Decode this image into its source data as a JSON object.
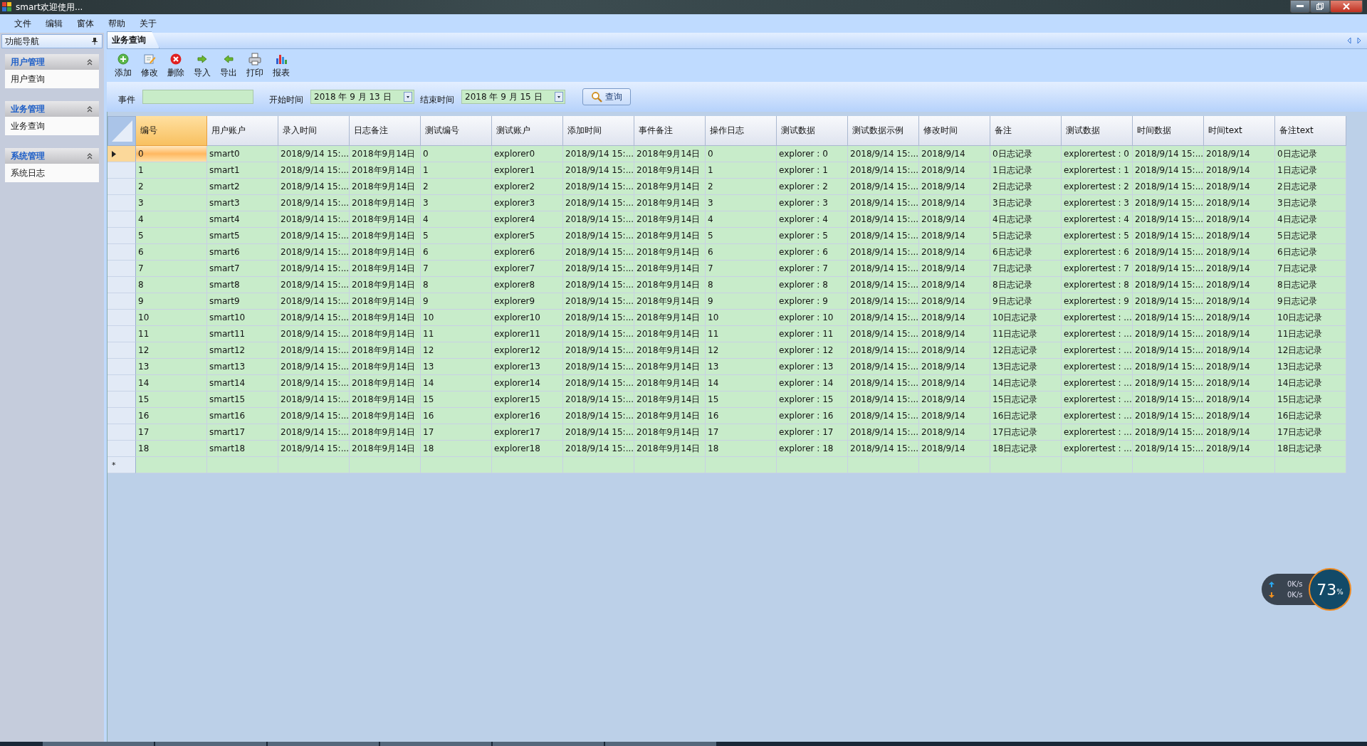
{
  "window": {
    "title": "smart欢迎使用..."
  },
  "menu": [
    "文件",
    "编辑",
    "窗体",
    "帮助",
    "关于"
  ],
  "sidebar": {
    "title": "功能导航",
    "groups": [
      {
        "title": "用户管理",
        "expanded": true,
        "items": [
          "用户查询"
        ]
      },
      {
        "title": "业务管理",
        "expanded": true,
        "items": [
          "业务查询"
        ]
      },
      {
        "title": "系统管理",
        "expanded": true,
        "items": [
          "系统日志"
        ]
      }
    ]
  },
  "tabs": [
    {
      "label": "业务查询",
      "selected": true
    }
  ],
  "toolbar": [
    {
      "kind": "add",
      "label": "添加"
    },
    {
      "kind": "edit",
      "label": "修改"
    },
    {
      "kind": "delete",
      "label": "删除"
    },
    {
      "kind": "import",
      "label": "导入"
    },
    {
      "kind": "export",
      "label": "导出"
    },
    {
      "kind": "print",
      "label": "打印"
    },
    {
      "kind": "report",
      "label": "报表"
    }
  ],
  "filter": {
    "event_label": "事件",
    "start_label": "开始时间",
    "start_date": "2018 年 9 月 13 日",
    "end_label": "结束时间",
    "end_date": "2018 年 9 月 15 日",
    "query_button": "查询"
  },
  "table": {
    "columns": [
      "编号",
      "用户账户",
      "录入时间",
      "日志备注",
      "测试编号",
      "测试账户",
      "添加时间",
      "事件备注",
      "操作日志",
      "测试数据",
      "测试数据示例",
      "修改时间",
      "备注",
      "测试数据",
      "时间数据",
      "时间text",
      "备注text"
    ],
    "new_row_marker": "*",
    "rows": [
      {
        "selected": true,
        "cells": [
          "0",
          "smart0",
          "2018/9/14 15:...",
          "2018年9月14日",
          "0",
          "explorer0",
          "2018/9/14 15:...",
          "2018年9月14日",
          "0",
          "explorer : 0",
          "2018/9/14 15:...",
          "2018/9/14",
          "0日志记录",
          "explorertest : 0",
          "2018/9/14 15:...",
          "2018/9/14",
          "0日志记录"
        ]
      },
      {
        "selected": false,
        "cells": [
          "1",
          "smart1",
          "2018/9/14 15:...",
          "2018年9月14日",
          "1",
          "explorer1",
          "2018/9/14 15:...",
          "2018年9月14日",
          "1",
          "explorer : 1",
          "2018/9/14 15:...",
          "2018/9/14",
          "1日志记录",
          "explorertest : 1",
          "2018/9/14 15:...",
          "2018/9/14",
          "1日志记录"
        ]
      },
      {
        "selected": false,
        "cells": [
          "2",
          "smart2",
          "2018/9/14 15:...",
          "2018年9月14日",
          "2",
          "explorer2",
          "2018/9/14 15:...",
          "2018年9月14日",
          "2",
          "explorer : 2",
          "2018/9/14 15:...",
          "2018/9/14",
          "2日志记录",
          "explorertest : 2",
          "2018/9/14 15:...",
          "2018/9/14",
          "2日志记录"
        ]
      },
      {
        "selected": false,
        "cells": [
          "3",
          "smart3",
          "2018/9/14 15:...",
          "2018年9月14日",
          "3",
          "explorer3",
          "2018/9/14 15:...",
          "2018年9月14日",
          "3",
          "explorer : 3",
          "2018/9/14 15:...",
          "2018/9/14",
          "3日志记录",
          "explorertest : 3",
          "2018/9/14 15:...",
          "2018/9/14",
          "3日志记录"
        ]
      },
      {
        "selected": false,
        "cells": [
          "4",
          "smart4",
          "2018/9/14 15:...",
          "2018年9月14日",
          "4",
          "explorer4",
          "2018/9/14 15:...",
          "2018年9月14日",
          "4",
          "explorer : 4",
          "2018/9/14 15:...",
          "2018/9/14",
          "4日志记录",
          "explorertest : 4",
          "2018/9/14 15:...",
          "2018/9/14",
          "4日志记录"
        ]
      },
      {
        "selected": false,
        "cells": [
          "5",
          "smart5",
          "2018/9/14 15:...",
          "2018年9月14日",
          "5",
          "explorer5",
          "2018/9/14 15:...",
          "2018年9月14日",
          "5",
          "explorer : 5",
          "2018/9/14 15:...",
          "2018/9/14",
          "5日志记录",
          "explorertest : 5",
          "2018/9/14 15:...",
          "2018/9/14",
          "5日志记录"
        ]
      },
      {
        "selected": false,
        "cells": [
          "6",
          "smart6",
          "2018/9/14 15:...",
          "2018年9月14日",
          "6",
          "explorer6",
          "2018/9/14 15:...",
          "2018年9月14日",
          "6",
          "explorer : 6",
          "2018/9/14 15:...",
          "2018/9/14",
          "6日志记录",
          "explorertest : 6",
          "2018/9/14 15:...",
          "2018/9/14",
          "6日志记录"
        ]
      },
      {
        "selected": false,
        "cells": [
          "7",
          "smart7",
          "2018/9/14 15:...",
          "2018年9月14日",
          "7",
          "explorer7",
          "2018/9/14 15:...",
          "2018年9月14日",
          "7",
          "explorer : 7",
          "2018/9/14 15:...",
          "2018/9/14",
          "7日志记录",
          "explorertest : 7",
          "2018/9/14 15:...",
          "2018/9/14",
          "7日志记录"
        ]
      },
      {
        "selected": false,
        "cells": [
          "8",
          "smart8",
          "2018/9/14 15:...",
          "2018年9月14日",
          "8",
          "explorer8",
          "2018/9/14 15:...",
          "2018年9月14日",
          "8",
          "explorer : 8",
          "2018/9/14 15:...",
          "2018/9/14",
          "8日志记录",
          "explorertest : 8",
          "2018/9/14 15:...",
          "2018/9/14",
          "8日志记录"
        ]
      },
      {
        "selected": false,
        "cells": [
          "9",
          "smart9",
          "2018/9/14 15:...",
          "2018年9月14日",
          "9",
          "explorer9",
          "2018/9/14 15:...",
          "2018年9月14日",
          "9",
          "explorer : 9",
          "2018/9/14 15:...",
          "2018/9/14",
          "9日志记录",
          "explorertest : 9",
          "2018/9/14 15:...",
          "2018/9/14",
          "9日志记录"
        ]
      },
      {
        "selected": false,
        "cells": [
          "10",
          "smart10",
          "2018/9/14 15:...",
          "2018年9月14日",
          "10",
          "explorer10",
          "2018/9/14 15:...",
          "2018年9月14日",
          "10",
          "explorer : 10",
          "2018/9/14 15:...",
          "2018/9/14",
          "10日志记录",
          "explorertest : ...",
          "2018/9/14 15:...",
          "2018/9/14",
          "10日志记录"
        ]
      },
      {
        "selected": false,
        "cells": [
          "11",
          "smart11",
          "2018/9/14 15:...",
          "2018年9月14日",
          "11",
          "explorer11",
          "2018/9/14 15:...",
          "2018年9月14日",
          "11",
          "explorer : 11",
          "2018/9/14 15:...",
          "2018/9/14",
          "11日志记录",
          "explorertest : ...",
          "2018/9/14 15:...",
          "2018/9/14",
          "11日志记录"
        ]
      },
      {
        "selected": false,
        "cells": [
          "12",
          "smart12",
          "2018/9/14 15:...",
          "2018年9月14日",
          "12",
          "explorer12",
          "2018/9/14 15:...",
          "2018年9月14日",
          "12",
          "explorer : 12",
          "2018/9/14 15:...",
          "2018/9/14",
          "12日志记录",
          "explorertest : ...",
          "2018/9/14 15:...",
          "2018/9/14",
          "12日志记录"
        ]
      },
      {
        "selected": false,
        "cells": [
          "13",
          "smart13",
          "2018/9/14 15:...",
          "2018年9月14日",
          "13",
          "explorer13",
          "2018/9/14 15:...",
          "2018年9月14日",
          "13",
          "explorer : 13",
          "2018/9/14 15:...",
          "2018/9/14",
          "13日志记录",
          "explorertest : ...",
          "2018/9/14 15:...",
          "2018/9/14",
          "13日志记录"
        ]
      },
      {
        "selected": false,
        "cells": [
          "14",
          "smart14",
          "2018/9/14 15:...",
          "2018年9月14日",
          "14",
          "explorer14",
          "2018/9/14 15:...",
          "2018年9月14日",
          "14",
          "explorer : 14",
          "2018/9/14 15:...",
          "2018/9/14",
          "14日志记录",
          "explorertest : ...",
          "2018/9/14 15:...",
          "2018/9/14",
          "14日志记录"
        ]
      },
      {
        "selected": false,
        "cells": [
          "15",
          "smart15",
          "2018/9/14 15:...",
          "2018年9月14日",
          "15",
          "explorer15",
          "2018/9/14 15:...",
          "2018年9月14日",
          "15",
          "explorer : 15",
          "2018/9/14 15:...",
          "2018/9/14",
          "15日志记录",
          "explorertest : ...",
          "2018/9/14 15:...",
          "2018/9/14",
          "15日志记录"
        ]
      },
      {
        "selected": false,
        "cells": [
          "16",
          "smart16",
          "2018/9/14 15:...",
          "2018年9月14日",
          "16",
          "explorer16",
          "2018/9/14 15:...",
          "2018年9月14日",
          "16",
          "explorer : 16",
          "2018/9/14 15:...",
          "2018/9/14",
          "16日志记录",
          "explorertest : ...",
          "2018/9/14 15:...",
          "2018/9/14",
          "16日志记录"
        ]
      },
      {
        "selected": false,
        "cells": [
          "17",
          "smart17",
          "2018/9/14 15:...",
          "2018年9月14日",
          "17",
          "explorer17",
          "2018/9/14 15:...",
          "2018年9月14日",
          "17",
          "explorer : 17",
          "2018/9/14 15:...",
          "2018/9/14",
          "17日志记录",
          "explorertest : ...",
          "2018/9/14 15:...",
          "2018/9/14",
          "17日志记录"
        ]
      },
      {
        "selected": false,
        "cells": [
          "18",
          "smart18",
          "2018/9/14 15:...",
          "2018年9月14日",
          "18",
          "explorer18",
          "2018/9/14 15:...",
          "2018年9月14日",
          "18",
          "explorer : 18",
          "2018/9/14 15:...",
          "2018/9/14",
          "18日志记录",
          "explorertest : ...",
          "2018/9/14 15:...",
          "2018/9/14",
          "18日志记录"
        ]
      }
    ]
  },
  "net_monitor": {
    "upload": "0K/s",
    "download": "0K/s",
    "percent": "73",
    "unit": "%"
  }
}
